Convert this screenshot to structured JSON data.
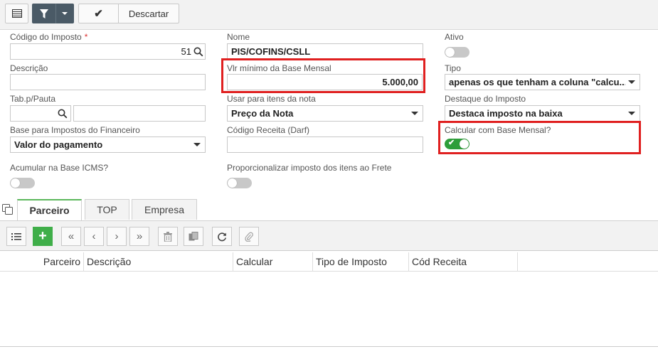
{
  "toolbar": {
    "discard_label": "Descartar"
  },
  "form": {
    "codigo_imposto": {
      "label": "Código do Imposto",
      "required_mark": "*",
      "value": "51"
    },
    "nome": {
      "label": "Nome",
      "value": "PIS/COFINS/CSLL"
    },
    "ativo": {
      "label": "Ativo",
      "on": false
    },
    "descricao": {
      "label": "Descrição",
      "value": ""
    },
    "vlr_minimo": {
      "label": "Vlr mínimo da Base Mensal",
      "value": "5.000,00"
    },
    "tipo": {
      "label": "Tipo",
      "value": "apenas os que tenham a coluna \"calcu..."
    },
    "tab_pauta": {
      "label": "Tab.p/Pauta",
      "value": "",
      "desc_value": ""
    },
    "usar_para_itens": {
      "label": "Usar para itens da nota",
      "value": "Preço da Nota"
    },
    "destaque": {
      "label": "Destaque do Imposto",
      "value": "Destaca imposto na baixa"
    },
    "base_financeiro": {
      "label": "Base para Impostos do Financeiro",
      "value": "Valor do pagamento"
    },
    "codigo_receita": {
      "label": "Código Receita (Darf)",
      "value": ""
    },
    "calcular_base_mensal": {
      "label": "Calcular com Base Mensal?",
      "on": true
    },
    "acumular_icms": {
      "label": "Acumular na Base ICMS?",
      "on": false
    },
    "proporcionalizar": {
      "label": "Proporcionalizar imposto dos itens ao Frete",
      "on": false
    }
  },
  "tabs": [
    {
      "label": "Parceiro",
      "active": true
    },
    {
      "label": "TOP",
      "active": false
    },
    {
      "label": "Empresa",
      "active": false
    }
  ],
  "grid": {
    "columns": [
      "Parceiro",
      "Descrição",
      "Calcular",
      "Tipo de Imposto",
      "Cód Receita"
    ],
    "rows": []
  },
  "colors": {
    "toggle_on": "#2e9e3a",
    "highlight": "#e02020",
    "add_button": "#3fae49",
    "tab_accent": "#5cb85c"
  }
}
